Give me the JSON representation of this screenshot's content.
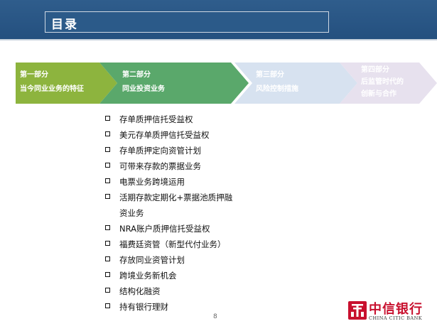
{
  "header": {
    "title": "目录"
  },
  "sections": [
    {
      "line1": "第一部分",
      "line2": "当今同业业务的特征",
      "fill": "#8db43e",
      "text_color": "#ffffff",
      "state": "done"
    },
    {
      "line1": "第二部分",
      "line2": "同业投资业务",
      "fill": "#5aa86b",
      "text_color": "#ffffff",
      "state": "active"
    },
    {
      "line1": "第三部分",
      "line2": "风险控制措施",
      "fill": "#d7e2f0",
      "text_color": "#ffffff",
      "state": "pending"
    },
    {
      "line1": "第四部分",
      "line2": "后监管时代的",
      "line3": "创新与合作",
      "fill": "#e7e1ee",
      "text_color": "#ffffff",
      "state": "pending"
    }
  ],
  "bullets": [
    "存单质押信托受益权",
    "美元存单质押信托受益权",
    "存单质押定向资管计划",
    "可带来存款的票据业务",
    "电票业务跨境运用",
    "活期存款定期化+票据池质押融资业务",
    "NRA账户质押信托受益权",
    "福费廷资管（新型代付业务）",
    "存放同业资管计划",
    "跨境业务新机会",
    "结构化融资",
    "持有银行理财"
  ],
  "footer": {
    "page_number": "8",
    "logo_cn": "中信银行",
    "logo_en": "CHINA CITIC BANK",
    "logo_icon": "citic-bank-logo-icon",
    "logo_color": "#c8102e"
  }
}
